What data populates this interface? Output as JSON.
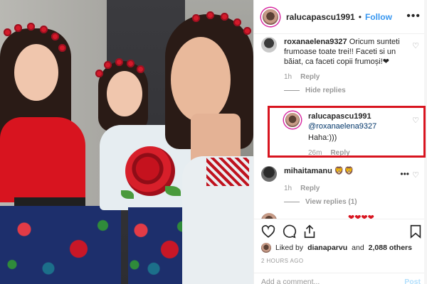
{
  "header": {
    "username": "ralucapascu1991",
    "separator": "•",
    "follow_label": "Follow",
    "more_label": "•••"
  },
  "comments": [
    {
      "username": "roxanaelena9327",
      "text": "Oricum sunteti frumoase toate trei!! Faceti si un băiat, ca faceti copii frumoși!❤",
      "time": "1h",
      "reply_label": "Reply",
      "replies_toggle": "Hide replies"
    },
    {
      "username": "ralucapascu1991",
      "mention": "@roxanaelena9327",
      "text": "Haha:)))",
      "time": "26m",
      "reply_label": "Reply"
    },
    {
      "username": "mihaitamanu",
      "text": "🦁🦁",
      "time": "1h",
      "reply_label": "Reply",
      "replies_toggle": "View replies (1)"
    }
  ],
  "partial_comment": {
    "text": "❤❤❤❤"
  },
  "likes": {
    "prefix": "Liked by",
    "user": "dianaparvu",
    "connector": "and",
    "others": "2,088 others"
  },
  "timestamp": "2 HOURS AGO",
  "add_comment": {
    "placeholder": "Add a comment...",
    "post_label": "Post"
  },
  "icons": [
    "heart-icon",
    "comment-icon",
    "share-icon",
    "bookmark-icon",
    "more-icon"
  ],
  "colors": {
    "follow": "#3897f0",
    "highlight": "#d8141f",
    "muted": "#999999"
  }
}
